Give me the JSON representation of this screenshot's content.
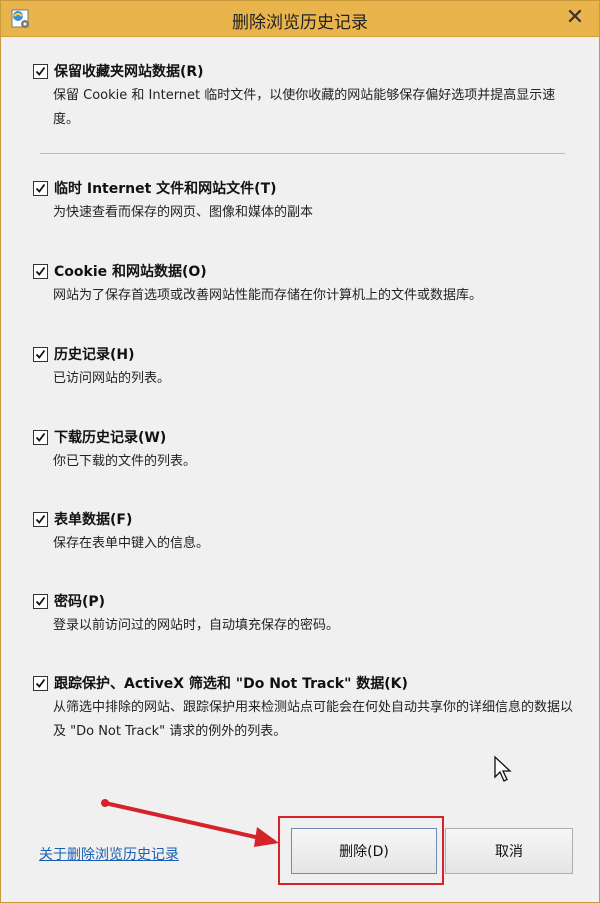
{
  "window": {
    "title": "删除浏览历史记录"
  },
  "options": [
    {
      "label": "保留收藏夹网站数据(R)",
      "checked": true,
      "description": "保留 Cookie 和 Internet 临时文件，以使你收藏的网站能够保存偏好选项并提高显示速度。"
    },
    {
      "label": "临时 Internet 文件和网站文件(T)",
      "checked": true,
      "description": "为快速查看而保存的网页、图像和媒体的副本"
    },
    {
      "label": "Cookie 和网站数据(O)",
      "checked": true,
      "description": "网站为了保存首选项或改善网站性能而存储在你计算机上的文件或数据库。"
    },
    {
      "label": "历史记录(H)",
      "checked": true,
      "description": "已访问网站的列表。"
    },
    {
      "label": "下载历史记录(W)",
      "checked": true,
      "description": "你已下载的文件的列表。"
    },
    {
      "label": "表单数据(F)",
      "checked": true,
      "description": "保存在表单中键入的信息。"
    },
    {
      "label": "密码(P)",
      "checked": true,
      "description": "登录以前访问过的网站时，自动填充保存的密码。"
    },
    {
      "label": "跟踪保护、ActiveX 筛选和 \"Do Not Track\" 数据(K)",
      "checked": true,
      "description": "从筛选中排除的网站、跟踪保护用来检测站点可能会在何处自动共享你的详细信息的数据以及 \"Do Not Track\" 请求的例外的列表。"
    }
  ],
  "footer": {
    "link": "关于删除浏览历史记录",
    "delete_button": "删除(D)",
    "cancel_button": "取消"
  },
  "colors": {
    "titlebar": "#e9b44c",
    "link": "#1a5fb4",
    "annotation": "#d6222a"
  }
}
